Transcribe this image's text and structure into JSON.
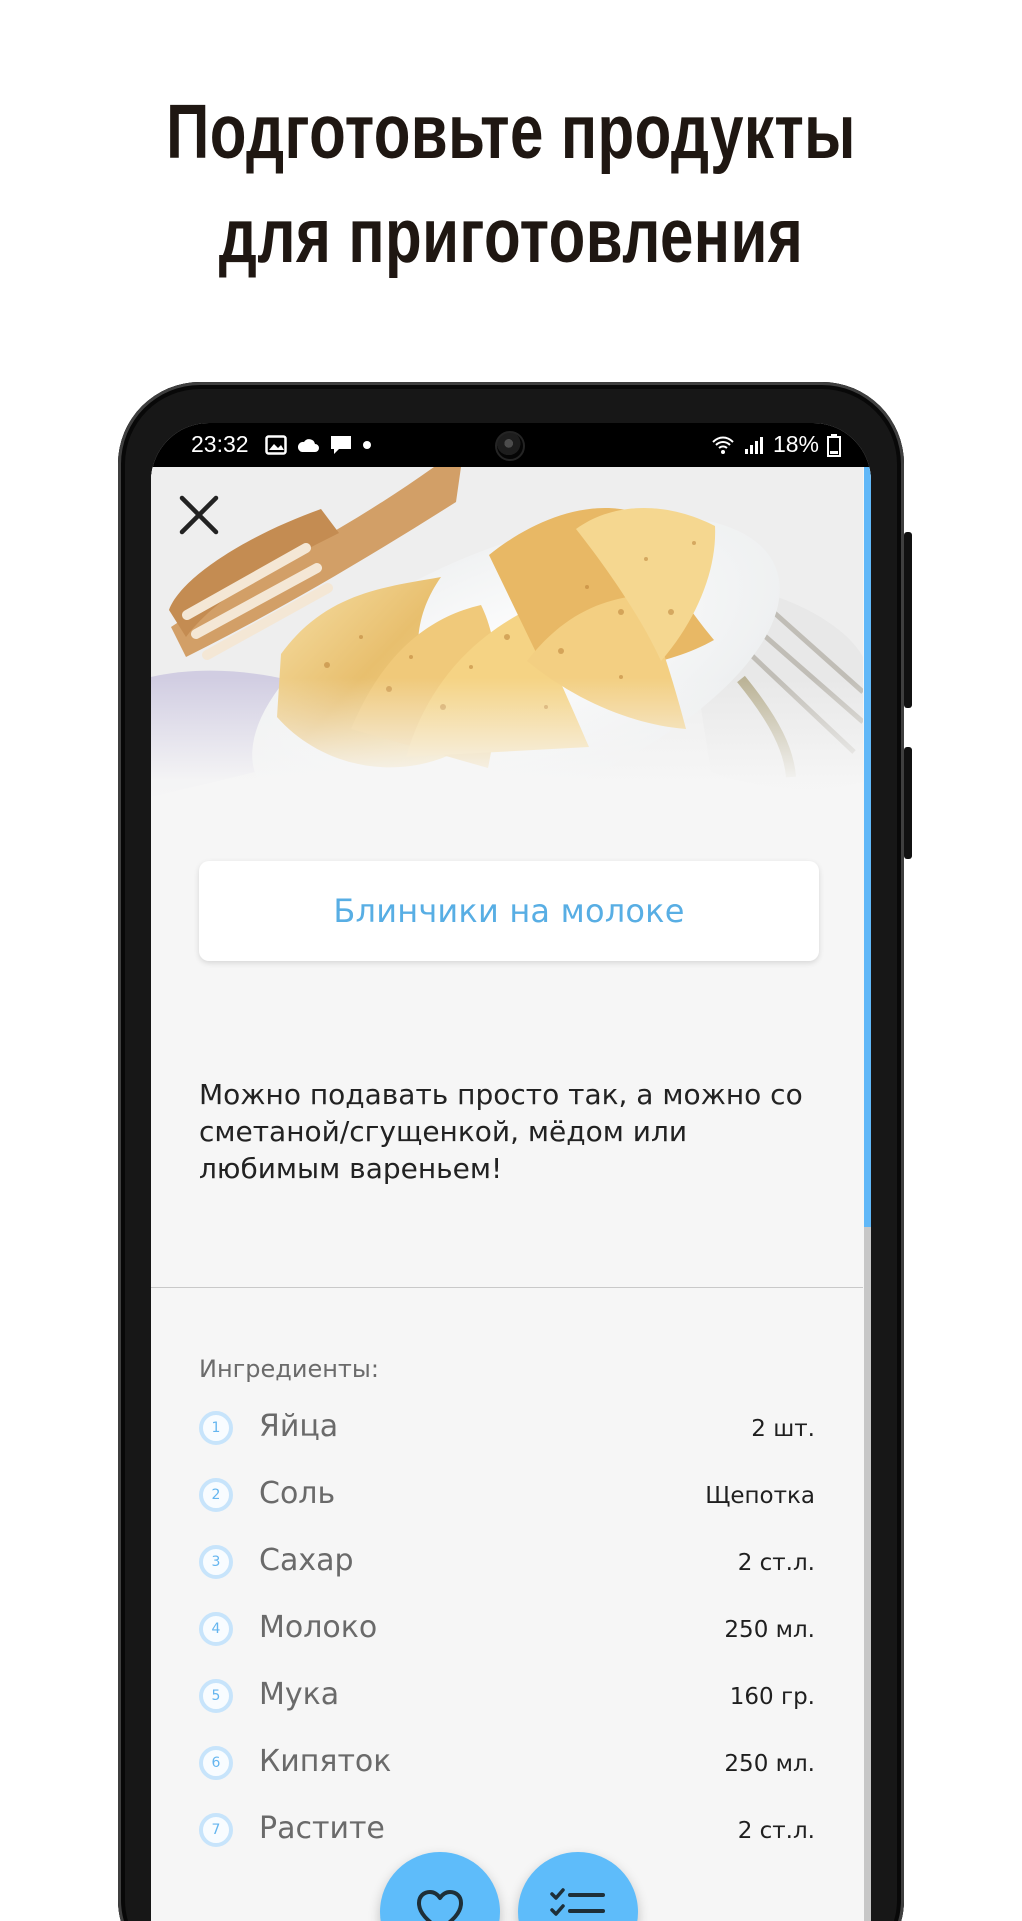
{
  "headline": {
    "line1": "Подготовьте продукты",
    "line2": "для приготовления"
  },
  "status_bar": {
    "time": "23:32",
    "battery": "18%"
  },
  "recipe": {
    "title": "Блинчики на молоке",
    "description": "Можно подавать просто так, а можно со сметаной/сгущенкой, мёдом или любимым вареньем!",
    "ingredients_label": "Ингредиенты:",
    "ingredients": [
      {
        "number": "1",
        "name": "Яйца",
        "quantity": "2 шт."
      },
      {
        "number": "2",
        "name": "Соль",
        "quantity": "Щепотка"
      },
      {
        "number": "3",
        "name": "Сахар",
        "quantity": "2 ст.л."
      },
      {
        "number": "4",
        "name": "Молоко",
        "quantity": "250 мл."
      },
      {
        "number": "5",
        "name": "Мука",
        "quantity": "160 гр."
      },
      {
        "number": "6",
        "name": "Кипяток",
        "quantity": "250 мл."
      },
      {
        "number": "7",
        "name": "Растите",
        "quantity": "2 ст.л."
      }
    ]
  },
  "icons": {
    "close": "close-icon",
    "favorite": "heart-icon",
    "steps": "checklist-icon",
    "gallery": "image-icon",
    "cloud": "cloud-icon",
    "message": "message-icon",
    "wifi": "wifi-icon",
    "signal": "signal-icon",
    "battery": "battery-icon"
  },
  "colors": {
    "accent": "#5ebcfa",
    "title_text": "#58aee4",
    "headline": "#1f1712",
    "background": "#f6f6f6"
  }
}
